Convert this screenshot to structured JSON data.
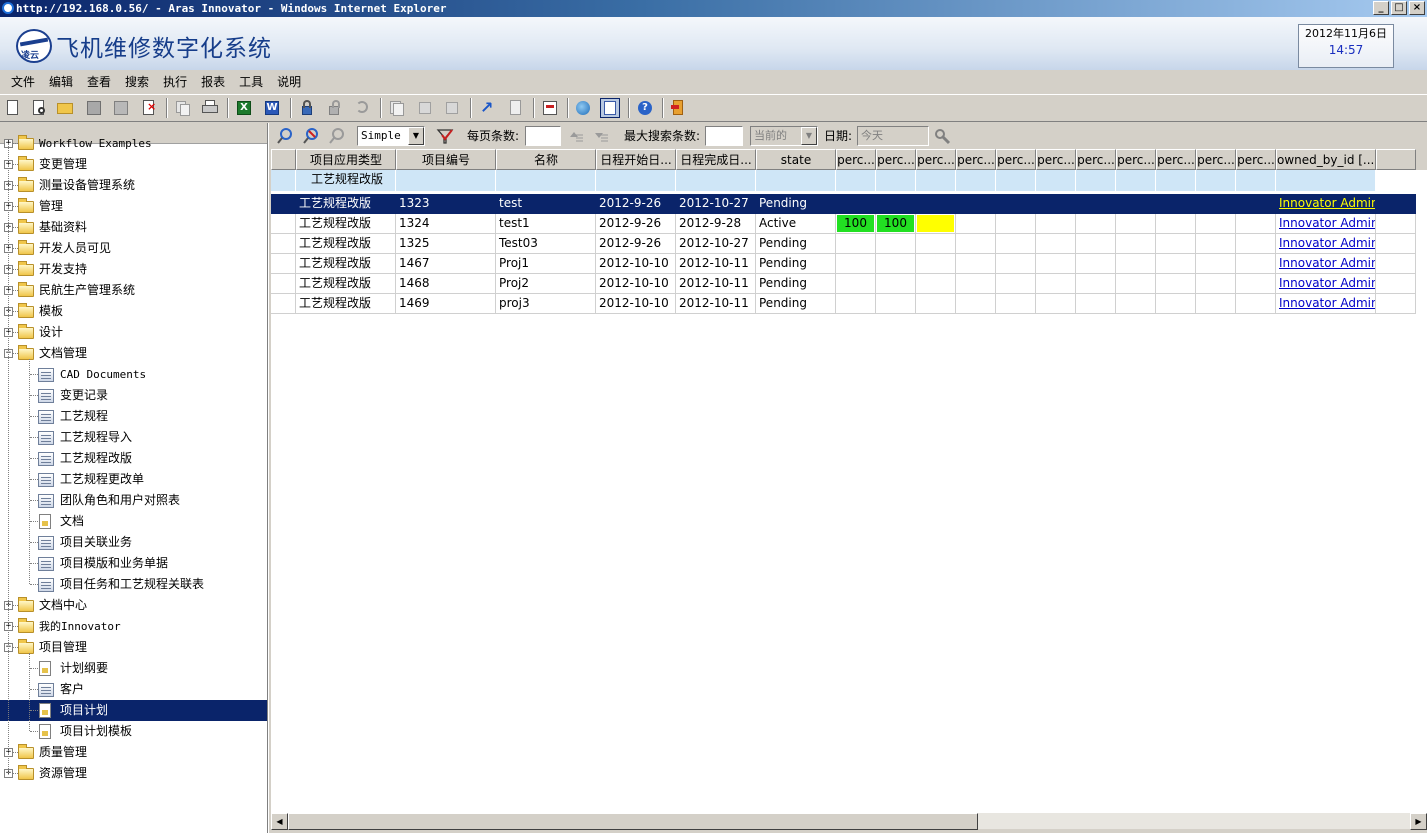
{
  "window": {
    "title": "http://192.168.0.56/ - Aras Innovator - Windows Internet Explorer",
    "minimize": "_",
    "maximize": "□",
    "close": "×"
  },
  "app": {
    "title": "飞机维修数字化系统",
    "logo_text": "凌云"
  },
  "clock": {
    "date": "2012年11月6日",
    "time": "14:57"
  },
  "menu": [
    "文件",
    "编辑",
    "查看",
    "搜索",
    "执行",
    "报表",
    "工具",
    "说明"
  ],
  "toolbar_icons": [
    "new-icon",
    "open-icon",
    "folder-open-icon",
    "save-icon",
    "save-as-icon",
    "delete-icon",
    "copy-icon",
    "print-icon",
    "excel-icon",
    "word-icon",
    "lock-icon",
    "unlock-icon",
    "undo-icon",
    "clone-icon",
    "promote-icon",
    "revert-icon",
    "export-icon",
    "search-doc-icon",
    "report-icon",
    "web-icon",
    "grid-icon",
    "help-icon",
    "logout-icon"
  ],
  "tree": [
    {
      "label": "Workflow Examples",
      "type": "folder",
      "mono": true
    },
    {
      "label": "变更管理",
      "type": "folder"
    },
    {
      "label": "测量设备管理系统",
      "type": "folder"
    },
    {
      "label": "管理",
      "type": "folder"
    },
    {
      "label": "基础资料",
      "type": "folder"
    },
    {
      "label": "开发人员可见",
      "type": "folder"
    },
    {
      "label": "开发支持",
      "type": "folder"
    },
    {
      "label": "民航生产管理系统",
      "type": "folder"
    },
    {
      "label": "模板",
      "type": "folder"
    },
    {
      "label": "设计",
      "type": "folder"
    },
    {
      "label": "文档管理",
      "type": "folder",
      "expanded": true
    },
    {
      "label": "CAD Documents",
      "type": "leaf",
      "mono": true
    },
    {
      "label": "变更记录",
      "type": "leaf"
    },
    {
      "label": "工艺规程",
      "type": "leaf"
    },
    {
      "label": "工艺规程导入",
      "type": "leaf"
    },
    {
      "label": "工艺规程改版",
      "type": "leaf"
    },
    {
      "label": "工艺规程更改单",
      "type": "leaf"
    },
    {
      "label": "团队角色和用户对照表",
      "type": "leaf"
    },
    {
      "label": "文档",
      "type": "doc"
    },
    {
      "label": "项目关联业务",
      "type": "leaf"
    },
    {
      "label": "项目模版和业务单据",
      "type": "leaf"
    },
    {
      "label": "项目任务和工艺规程关联表",
      "type": "leaf"
    },
    {
      "label": "文档中心",
      "type": "folder"
    },
    {
      "label": "我的Innovator",
      "type": "folder",
      "mono": true
    },
    {
      "label": "项目管理",
      "type": "folder",
      "expanded": true
    },
    {
      "label": "计划纲要",
      "type": "doc"
    },
    {
      "label": "客户",
      "type": "leaf"
    },
    {
      "label": "项目计划",
      "type": "doc",
      "selected": true
    },
    {
      "label": "项目计划模板",
      "type": "doc"
    },
    {
      "label": "质量管理",
      "type": "folder"
    },
    {
      "label": "资源管理",
      "type": "folder"
    }
  ],
  "search": {
    "mode": "Simple",
    "page_size_label": "每页条数:",
    "page_size_value": "",
    "max_results_label": "最大搜索条数:",
    "max_results_value": "",
    "version_value": "当前的",
    "date_label": "日期:",
    "date_value": "今天"
  },
  "grid": {
    "columns": [
      "项目应用类型",
      "项目编号",
      "名称",
      "日程开始日...",
      "日程完成日...",
      "state",
      "perc...",
      "perc...",
      "perc...",
      "perc...",
      "perc...",
      "perc...",
      "perc...",
      "perc...",
      "perc...",
      "perc...",
      "perc...",
      "owned_by_id [...]"
    ],
    "filter_row": [
      "工艺规程改版",
      "",
      "",
      "",
      "",
      "",
      "",
      "",
      "",
      "",
      "",
      "",
      "",
      "",
      "",
      "",
      "",
      ""
    ],
    "rows": [
      {
        "type": "工艺规程改版",
        "number": "1323",
        "name": "test",
        "start": "2012-9-26",
        "end": "2012-10-27",
        "state": "Pending",
        "owner": "Innovator Admin",
        "selected": true
      },
      {
        "type": "工艺规程改版",
        "number": "1324",
        "name": "test1",
        "start": "2012-9-26",
        "end": "2012-9-28",
        "state": "Active",
        "owner": "Innovator Admin",
        "perc": [
          "100",
          "100",
          ""
        ]
      },
      {
        "type": "工艺规程改版",
        "number": "1325",
        "name": "Test03",
        "start": "2012-9-26",
        "end": "2012-10-27",
        "state": "Pending",
        "owner": "Innovator Admin"
      },
      {
        "type": "工艺规程改版",
        "number": "1467",
        "name": "Proj1",
        "start": "2012-10-10",
        "end": "2012-10-11",
        "state": "Pending",
        "owner": "Innovator Admin"
      },
      {
        "type": "工艺规程改版",
        "number": "1468",
        "name": "Proj2",
        "start": "2012-10-10",
        "end": "2012-10-11",
        "state": "Pending",
        "owner": "Innovator Admin"
      },
      {
        "type": "工艺规程改版",
        "number": "1469",
        "name": "proj3",
        "start": "2012-10-10",
        "end": "2012-10-11",
        "state": "Pending",
        "owner": "Innovator Admin"
      }
    ],
    "perc_colors": [
      "#22e022",
      "#22e022",
      "#ffff00"
    ]
  }
}
